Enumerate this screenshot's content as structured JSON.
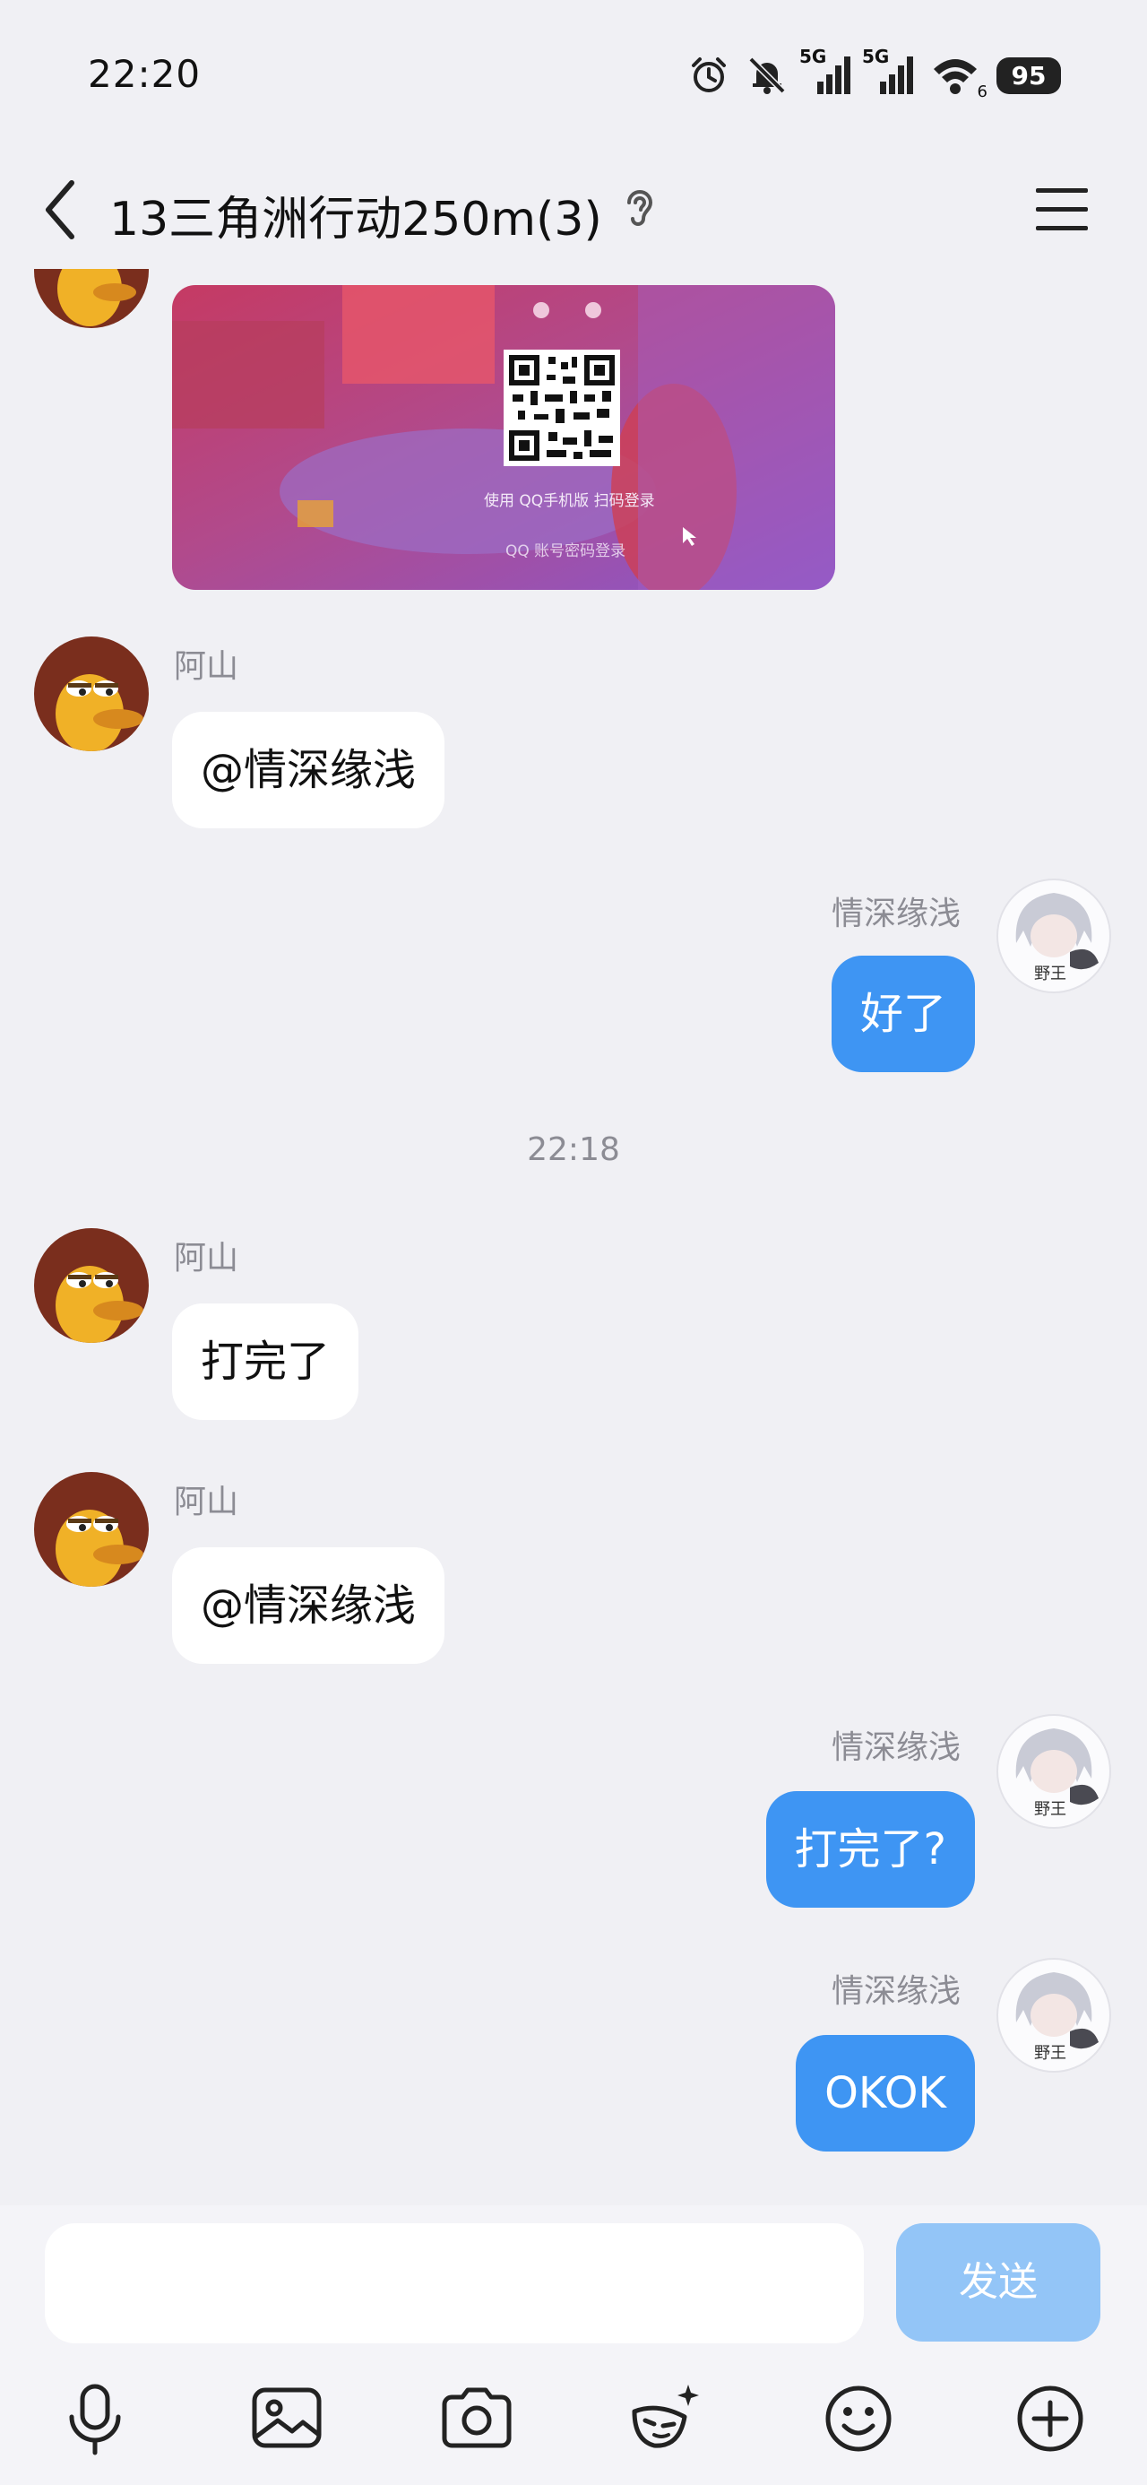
{
  "status_bar": {
    "time": "22:20",
    "signal1_label": "5G",
    "signal2_label": "5G",
    "wifi_label": "6",
    "battery": "95"
  },
  "header": {
    "title": "13三角洲行动250m(3)",
    "back_icon": "chevron-left-icon",
    "ear_icon": "ear-icon",
    "menu_icon": "hamburger-menu-icon"
  },
  "image_message": {
    "caption1": "使用 QQ手机版 扫码登录",
    "caption2": "QQ 账号密码登录"
  },
  "messages": [
    {
      "sender": "阿山",
      "text": "@情深缘浅",
      "side": "left"
    },
    {
      "sender": "情深缘浅",
      "text": "好了",
      "side": "right"
    },
    {
      "timestamp": "22:18"
    },
    {
      "sender": "阿山",
      "text": "打完了",
      "side": "left"
    },
    {
      "sender": "阿山",
      "text": "@情深缘浅",
      "side": "left"
    },
    {
      "sender": "情深缘浅",
      "text": "打完了?",
      "side": "right"
    },
    {
      "sender": "情深缘浅",
      "text": "OKOK",
      "side": "right"
    }
  ],
  "input": {
    "value": "",
    "send_label": "发送"
  },
  "toolbar": {
    "icons": [
      "microphone-icon",
      "image-icon",
      "camera-icon",
      "sticker-icon",
      "emoji-icon",
      "plus-icon"
    ]
  },
  "colors": {
    "background": "#f0f0f4",
    "bubble_right": "#3e95f3",
    "bubble_left": "#ffffff",
    "send_button": "#93c5f7"
  }
}
